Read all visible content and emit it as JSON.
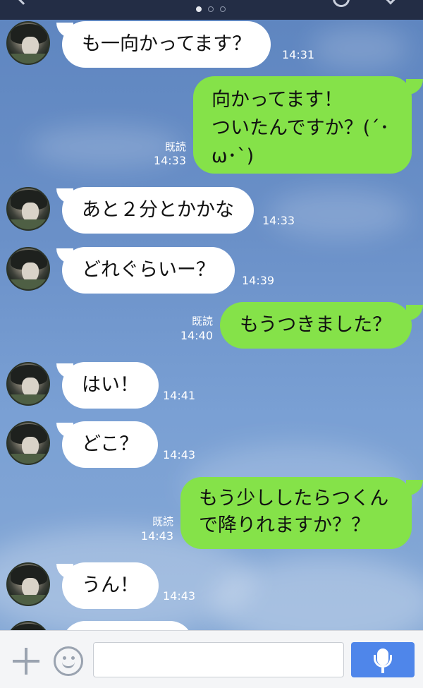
{
  "colors": {
    "header": "#232d45",
    "incoming_bubble": "#ffffff",
    "outgoing_bubble": "#85e249",
    "send_button": "#4f86ea"
  },
  "header": {
    "icons": [
      "back-icon",
      "page-dots-icon",
      "circle-icon",
      "chevron-icon"
    ],
    "page_indicator": {
      "count": 3,
      "active": 1
    }
  },
  "messages": [
    {
      "side": "in",
      "text": "も一向かってます？",
      "time": "14:31"
    },
    {
      "side": "out",
      "text": "向かってます！\nついたんですか？(´･ω･`)",
      "time": "14:33",
      "read": "既読"
    },
    {
      "side": "in",
      "text": "あと２分とかかな",
      "time": "14:33"
    },
    {
      "side": "in",
      "text": "どれぐらいー？",
      "time": "14:39"
    },
    {
      "side": "out",
      "text": "もうつきました？",
      "time": "14:40",
      "read": "既読"
    },
    {
      "side": "in",
      "text": "はい！",
      "time": "14:41"
    },
    {
      "side": "in",
      "text": "どこ？",
      "time": "14:43"
    },
    {
      "side": "out",
      "text": "もう少ししたらつくん\nで降りれますか？？",
      "time": "14:43",
      "read": "既読"
    },
    {
      "side": "in",
      "text": "うん！",
      "time": "14:43"
    }
  ],
  "input_bar": {
    "icons": [
      "plus-icon",
      "emoji-icon",
      "microphone-icon"
    ],
    "input_value": "",
    "input_placeholder": ""
  }
}
